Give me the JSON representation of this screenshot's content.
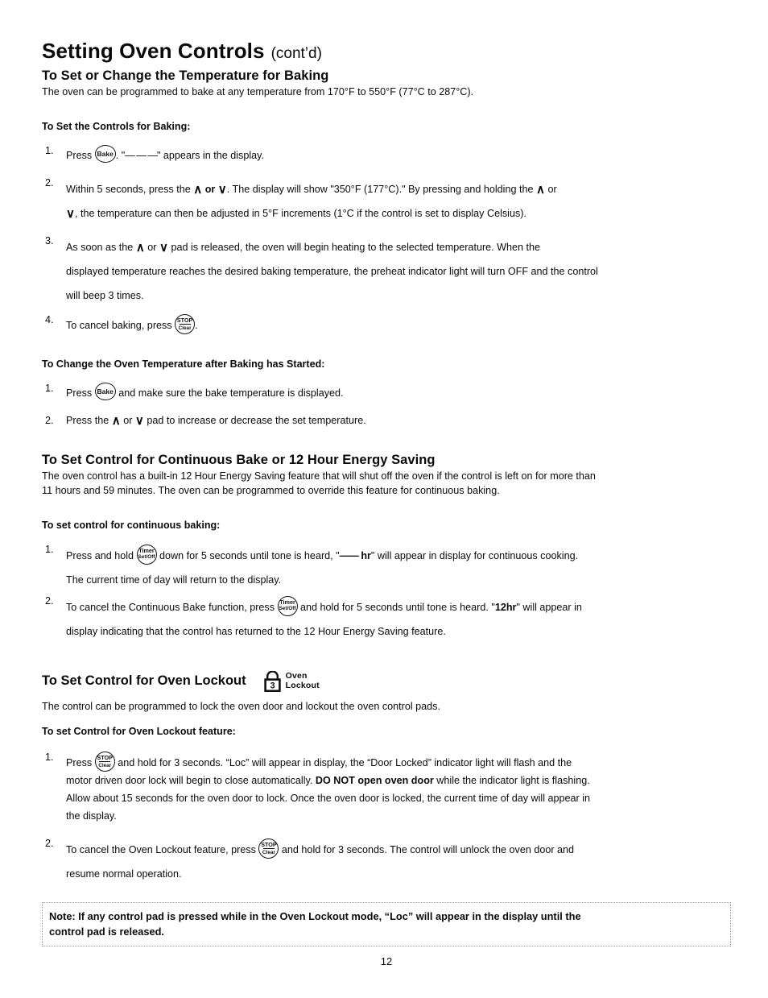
{
  "document": {
    "title_main": "Setting Oven Controls",
    "title_cont": "(cont’d)",
    "page_number": "12"
  },
  "section_baking": {
    "heading": "To Set or Change the Temperature for Baking",
    "intro": "The oven can be programmed to bake at any temperature from 170°F to 550°F (77°C to 287°C).",
    "subheading": "To Set the Controls for Baking:",
    "steps": [
      {
        "num": "1.",
        "pre": "Press",
        "icon": "bake-pad",
        "line1_a": ". \"",
        "dashes": "— — —",
        "line1_b": "\" appears in the display."
      },
      {
        "num": "2.",
        "a": "Within 5 seconds, press the",
        "up": "∧",
        "or": "or",
        "down": "∨",
        "b": ". The display will show \"350°F (177°C).\" By pressing and holding the",
        "c": "or",
        "d": ", the temperature can then be adjusted in 5°F increments (1°C if the control is set to display Celsius)."
      },
      {
        "num": "3.",
        "a": "As soon as the",
        "up": "∧",
        "or": "or",
        "down": "∨",
        "b": "pad is released, the oven will begin heating to the selected temperature. When the",
        "c": "displayed temperature reaches the desired baking temperature, the preheat indicator light will turn OFF and the control",
        "d": "will beep 3 times."
      },
      {
        "num": "4.",
        "a": "To cancel baking, press",
        "icon": "stop-clear-pad",
        "b": "."
      }
    ]
  },
  "section_change_temp": {
    "subheading": "To Change the Oven Temperature after Baking has Started:",
    "steps": [
      {
        "num": "1.",
        "a": "Press",
        "icon": "bake-pad",
        "b": "and make sure the bake temperature is displayed."
      },
      {
        "num": "2.",
        "a": "Press the",
        "up": "∧",
        "or": "or",
        "down": "∨",
        "b": "pad to increase or decrease the set temperature."
      }
    ]
  },
  "section_continuous": {
    "heading": "To Set Control for Continuous Bake or 12 Hour Energy Saving",
    "intro_line1": "The oven control has a built-in 12 Hour Energy Saving feature that will shut off the oven if the control is left on for more than",
    "intro_line2": "11 hours and 59 minutes. The oven can be programmed to override this feature for continuous baking.",
    "subheading": "To set control for continuous baking:",
    "steps": [
      {
        "num": "1.",
        "a": "Press and hold",
        "icon": "timer-setoff-pad",
        "b": "down for 5 seconds until tone is heard, \"",
        "dashes": "——",
        "hr": "hr",
        "c": "\" will appear in display for continuous cooking.",
        "d": "The current time of day will return to the display."
      },
      {
        "num": "2.",
        "a": "To cancel the Continuous Bake function, press",
        "icon": "timer-setoff-pad",
        "b": "and hold for 5 seconds until tone is heard. \"",
        "bold_val": "12hr",
        "c": "\" will appear in",
        "d": "display indicating that the control has returned to the 12 Hour Energy Saving feature."
      }
    ]
  },
  "section_lockout": {
    "heading": "To Set Control for Oven Lockout",
    "badge": {
      "icon": "padlock-icon",
      "lock_digit": "3",
      "label_line1": "Oven",
      "label_line2": "Lockout"
    },
    "intro": "The control can be programmed to lock the oven door and lockout the oven control pads.",
    "subheading": "To set Control for Oven Lockout feature:",
    "steps": [
      {
        "num": "1.",
        "a": "Press",
        "icon": "stop-clear-pad",
        "b": "and hold for 3 seconds. “Loc” will appear in display, the “Door Locked” indicator light will flash and the",
        "c_pre": "motor driven door lock will begin to close automatically. ",
        "c_bold": "DO NOT open oven door",
        "c_post": " while the indicator light is flashing.",
        "d": "Allow about 15 seconds for the oven door to lock. Once the oven door is locked, the current time of day will appear in",
        "e": "the display."
      },
      {
        "num": "2.",
        "a": "To cancel the Oven Lockout feature, press",
        "icon": "stop-clear-pad",
        "b": "and hold for 3 seconds. The control will unlock the oven door and",
        "c": "resume normal operation."
      }
    ]
  },
  "note": {
    "line1": "Note: If any control pad is pressed while in the Oven Lockout mode, “Loc” will appear in the display until the",
    "line2": "control pad is released."
  },
  "pads": {
    "bake": {
      "label": "Bake"
    },
    "stop_clear": {
      "top": "STOP",
      "bottom": "Clear"
    },
    "timer": {
      "top": "Timer",
      "bottom": "Set/Off"
    }
  }
}
